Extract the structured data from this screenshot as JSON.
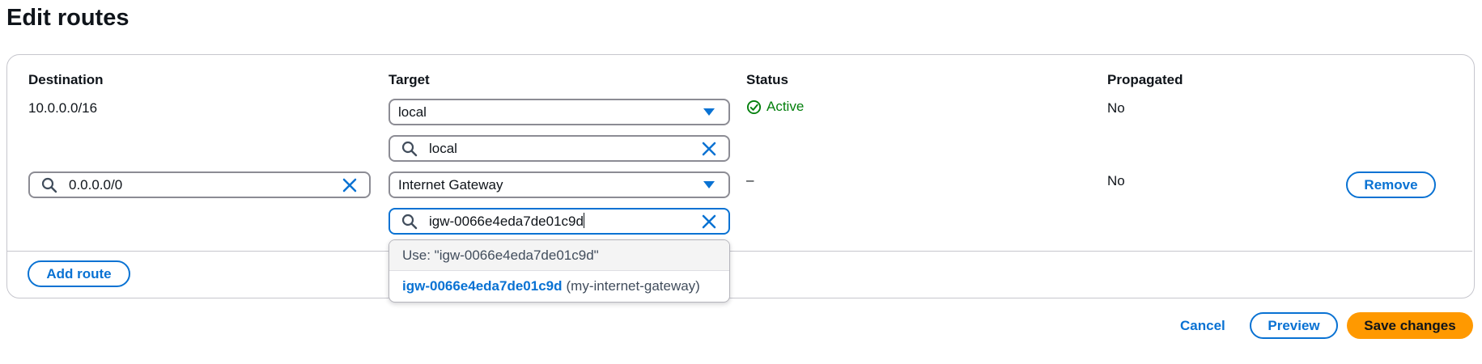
{
  "page": {
    "title": "Edit routes"
  },
  "table": {
    "headers": {
      "destination": "Destination",
      "target": "Target",
      "status": "Status",
      "propagated": "Propagated"
    },
    "rows": [
      {
        "destination": "10.0.0.0/16",
        "target_select": "local",
        "target_search": "local",
        "status": "Active",
        "propagated": "No"
      },
      {
        "destination_input": "0.0.0.0/0",
        "target_select": "Internet Gateway",
        "target_search": "igw-0066e4eda7de01c9d",
        "status": "–",
        "propagated": "No",
        "remove_label": "Remove"
      }
    ]
  },
  "dropdown": {
    "use_option": "Use: \"igw-0066e4eda7de01c9d\"",
    "options": [
      {
        "id": "igw-0066e4eda7de01c9d",
        "description": "(my-internet-gateway)"
      }
    ]
  },
  "actions": {
    "add_route": "Add route",
    "cancel": "Cancel",
    "preview": "Preview",
    "save": "Save changes"
  },
  "colors": {
    "accent": "#0972d3",
    "success": "#037f0c",
    "primary_button": "#ff9900",
    "border": "#8c8c94"
  },
  "icons": {
    "search": "search-icon",
    "clear": "close-icon",
    "caret": "caret-down-icon",
    "status": "check-circle-icon"
  }
}
